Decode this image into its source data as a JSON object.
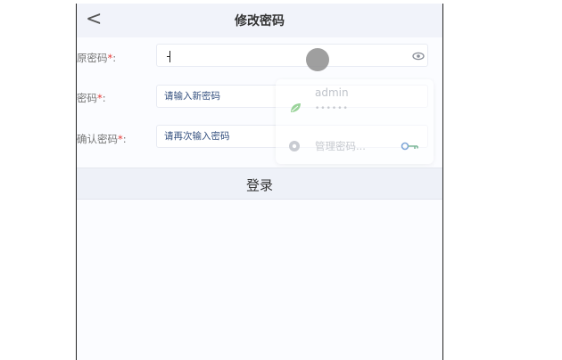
{
  "header": {
    "back_icon": "chevron-left-icon",
    "back_glyph": "<",
    "title": "修改密码"
  },
  "form": {
    "fields": [
      {
        "label": "原密码",
        "required_mark": "*",
        "suffix": ":",
        "value": "",
        "placeholder": "",
        "has_eye_icon": true
      },
      {
        "label": "密码",
        "required_mark": "*",
        "suffix": ":",
        "value": "",
        "placeholder": "请输入新密码"
      },
      {
        "label": "确认密码",
        "required_mark": "*",
        "suffix": ":",
        "value": "",
        "placeholder": "请再次输入密码"
      }
    ],
    "required_color": "#e53935"
  },
  "autofill": {
    "username": "admin",
    "password_mask": "••••••",
    "manage_label": "管理密码...",
    "user_icon": "leaf-icon",
    "manage_icon": "gear-icon",
    "key_icon": "key-icon"
  },
  "submit": {
    "label": "登录"
  }
}
